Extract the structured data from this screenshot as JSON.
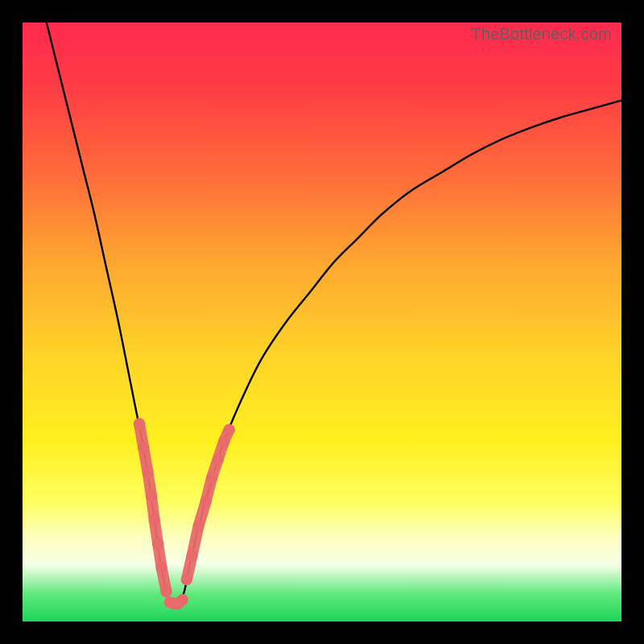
{
  "watermark": "TheBottleneck.com",
  "colors": {
    "gradient_stops": [
      {
        "offset": 0.0,
        "color": "#ff2a4f"
      },
      {
        "offset": 0.1,
        "color": "#ff3a46"
      },
      {
        "offset": 0.25,
        "color": "#ff6a3a"
      },
      {
        "offset": 0.4,
        "color": "#ffa631"
      },
      {
        "offset": 0.55,
        "color": "#ffd228"
      },
      {
        "offset": 0.7,
        "color": "#fff020"
      },
      {
        "offset": 0.8,
        "color": "#ffff60"
      },
      {
        "offset": 0.86,
        "color": "#ffffc0"
      },
      {
        "offset": 0.905,
        "color": "#f6ffe8"
      },
      {
        "offset": 0.955,
        "color": "#5fe87a"
      },
      {
        "offset": 1.0,
        "color": "#1dd65a"
      }
    ],
    "curve": "#000000",
    "marker_fill": "#e96a6a",
    "marker_stroke": "#d85a5a",
    "frame": "#000000"
  },
  "chart_data": {
    "type": "line",
    "title": "",
    "xlabel": "",
    "ylabel": "",
    "xlim": [
      0,
      100
    ],
    "ylim": [
      0,
      100
    ],
    "grid": false,
    "series": [
      {
        "name": "bottleneck-curve",
        "x": [
          4,
          6,
          8,
          10,
          12,
          14,
          16,
          18,
          19,
          20,
          21,
          22,
          23,
          24,
          25,
          26,
          27,
          28,
          30,
          32,
          34,
          37,
          40,
          44,
          48,
          52,
          56,
          60,
          65,
          70,
          75,
          80,
          85,
          90,
          95,
          100
        ],
        "y": [
          100,
          92,
          84,
          76,
          68,
          59,
          50,
          40,
          35,
          30,
          24,
          17,
          10,
          5,
          3,
          3,
          5,
          10,
          18,
          25,
          31,
          38,
          44,
          50,
          55,
          60,
          64,
          68,
          72,
          75,
          78,
          80.5,
          82.5,
          84.2,
          85.6,
          87
        ]
      }
    ],
    "marker_clusters": [
      {
        "name": "left-cluster",
        "x": [
          19.5,
          20.2,
          20.9,
          21.5,
          22.0,
          22.6,
          23.2,
          24.0
        ],
        "y": [
          33,
          29,
          25,
          21,
          17,
          13,
          9,
          5
        ]
      },
      {
        "name": "bottom-cluster",
        "x": [
          24.6,
          25.3,
          26.0,
          26.7
        ],
        "y": [
          3.2,
          3.0,
          3.0,
          3.6
        ]
      },
      {
        "name": "right-cluster",
        "x": [
          27.4,
          28.3,
          29.4,
          30.6,
          31.6,
          32.6,
          33.6,
          34.5
        ],
        "y": [
          7,
          11,
          16,
          20,
          24,
          27,
          30,
          32
        ]
      }
    ]
  }
}
